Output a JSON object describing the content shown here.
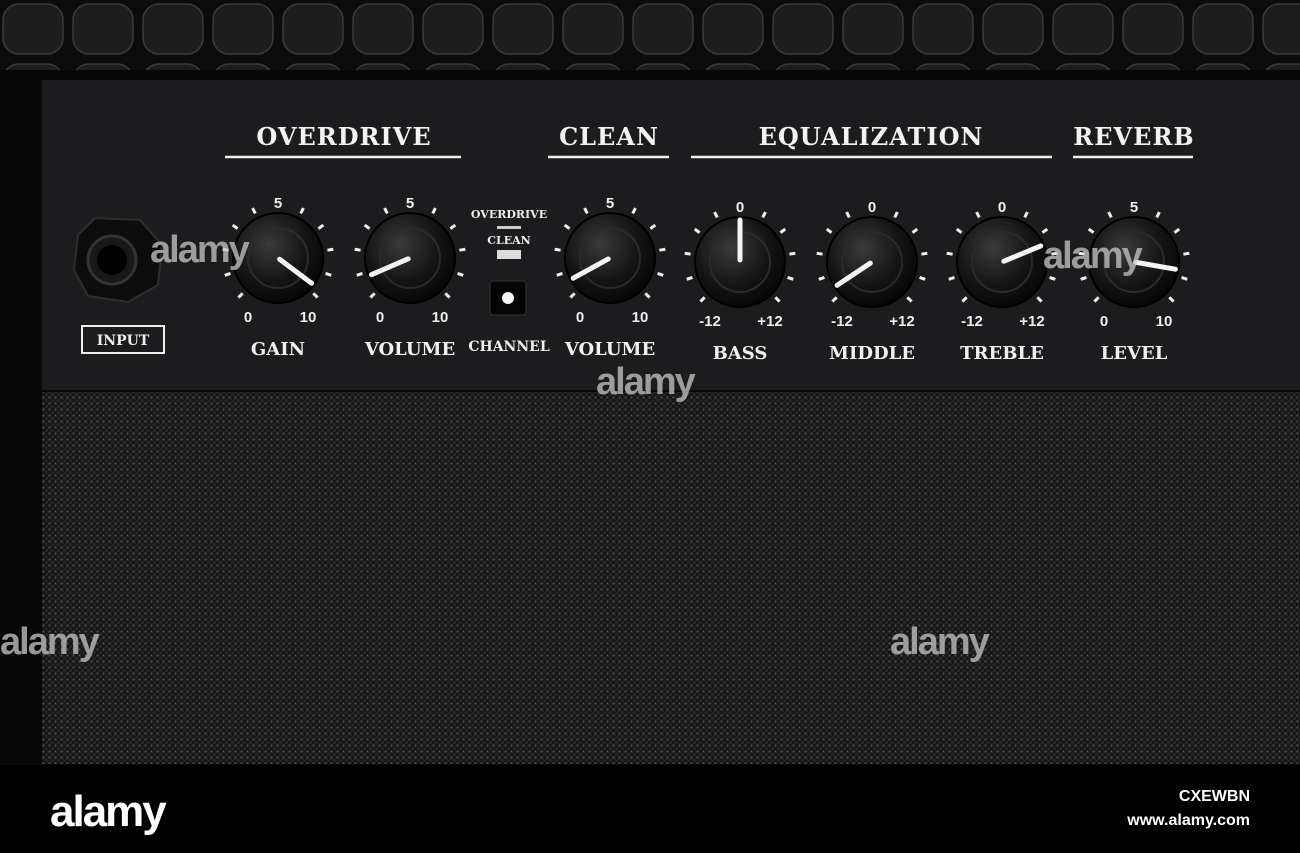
{
  "panel": {
    "sections": [
      {
        "title": "OVERDRIVE"
      },
      {
        "title": "CLEAN"
      },
      {
        "title": "EQUALIZATION"
      },
      {
        "title": "REVERB"
      }
    ],
    "input_label": "INPUT",
    "channel": {
      "top": "OVERDRIVE",
      "bottom": "CLEAN",
      "label": "CHANNEL"
    },
    "knobs": [
      {
        "label": "GAIN",
        "min": "0",
        "mid": "5",
        "max": "10",
        "value": 9.7
      },
      {
        "label": "VOLUME",
        "min": "0",
        "mid": "5",
        "max": "10",
        "value": 0.8
      },
      {
        "label": "VOLUME",
        "min": "0",
        "mid": "5",
        "max": "10",
        "value": 0.6
      },
      {
        "label": "BASS",
        "min": "-12",
        "mid": "0",
        "max": "+12",
        "value": 0
      },
      {
        "label": "MIDDLE",
        "min": "-12",
        "mid": "0",
        "max": "+12",
        "value": -11
      },
      {
        "label": "TREBLE",
        "min": "-12",
        "mid": "0",
        "max": "+12",
        "value": 6
      },
      {
        "label": "LEVEL",
        "min": "0",
        "mid": "5",
        "max": "10",
        "value": 8.7
      }
    ]
  },
  "watermark": {
    "text": "alamy",
    "site": "www.alamy.com",
    "image_code": "CXEWBN"
  },
  "colors": {
    "panel": "#1c1c1e",
    "grille": "#1a1a1a",
    "pointer": "#f4f4f0"
  }
}
